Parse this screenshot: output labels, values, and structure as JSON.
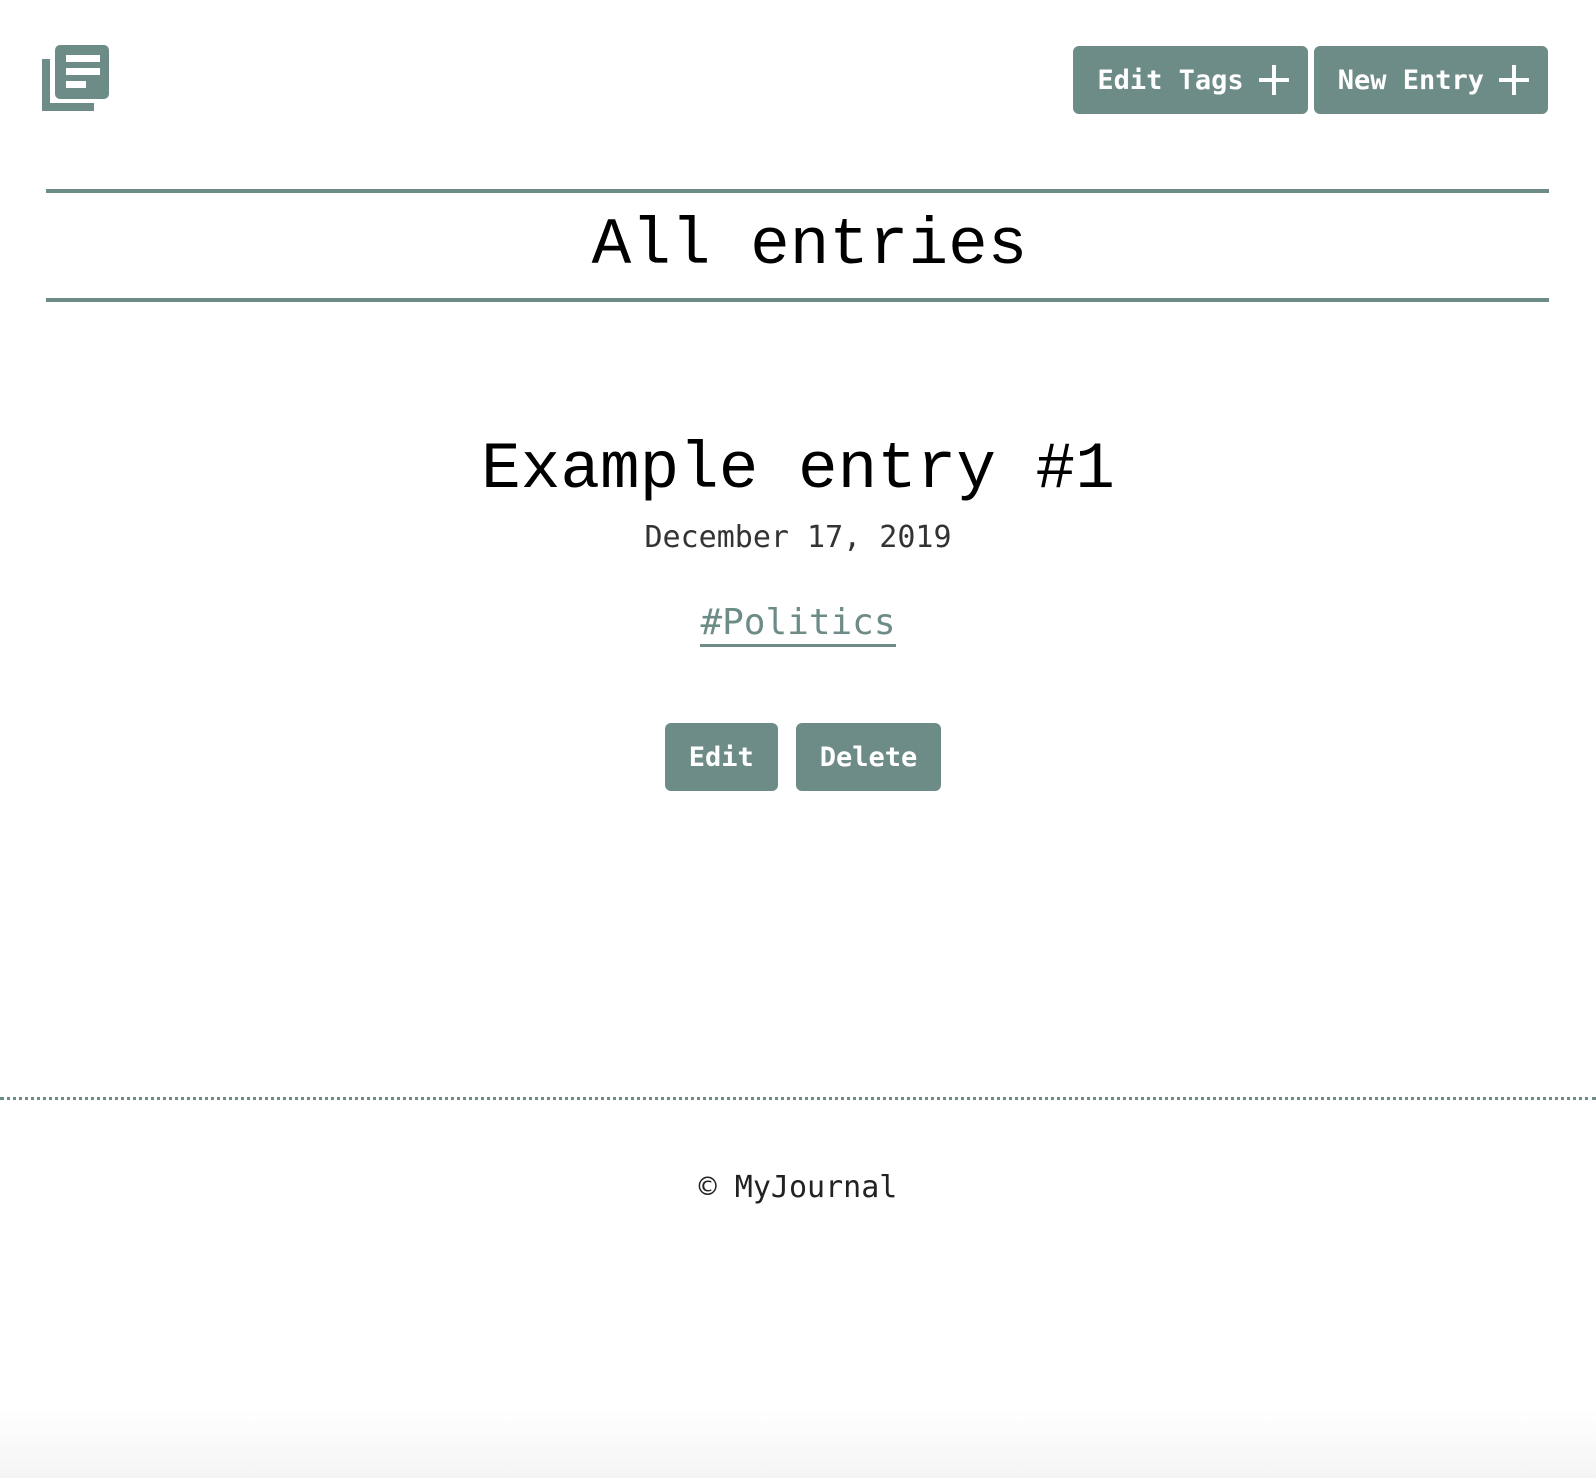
{
  "header": {
    "logo_icon": "journal-stack-icon",
    "edit_tags_label": "Edit Tags",
    "new_entry_label": "New Entry",
    "plus_icon": "plus-icon"
  },
  "main": {
    "title": "All entries",
    "entries": [
      {
        "title": "Example entry #1",
        "date": "December 17, 2019",
        "tag": "#Politics",
        "edit_label": "Edit",
        "delete_label": "Delete"
      }
    ]
  },
  "footer": {
    "text": "© MyJournal"
  },
  "colors": {
    "accent": "#6e8c87",
    "button_text": "#ffffff",
    "background": "#ffffff"
  }
}
